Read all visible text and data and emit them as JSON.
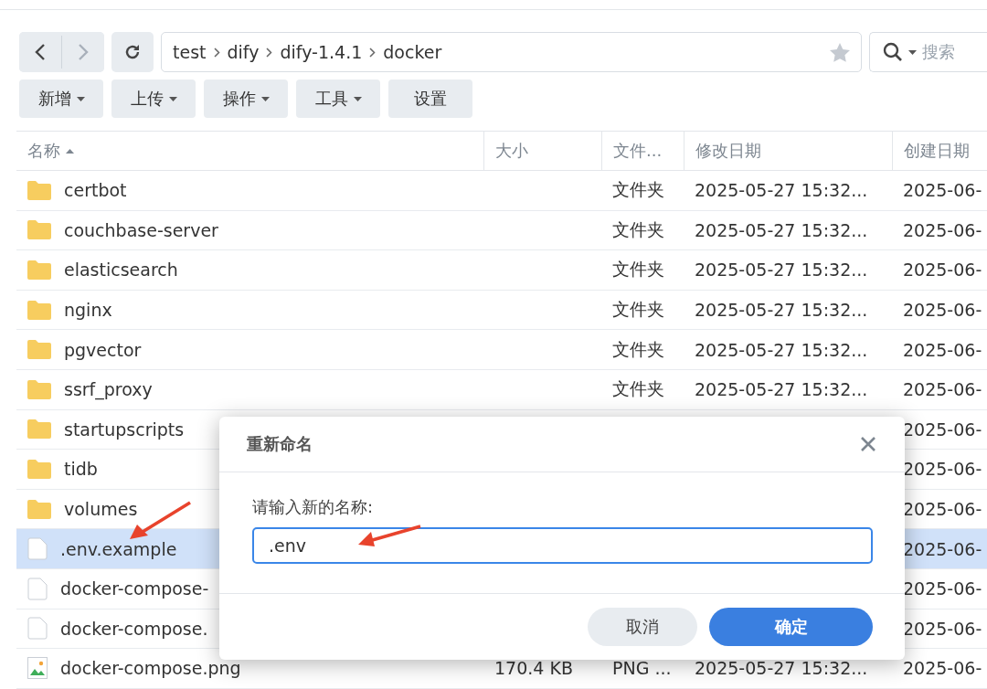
{
  "breadcrumb": [
    "test",
    "dify",
    "dify-1.4.1",
    "docker"
  ],
  "search": {
    "placeholder": "搜索"
  },
  "toolbar": [
    {
      "label": "新增",
      "dropdown": true
    },
    {
      "label": "上传",
      "dropdown": true
    },
    {
      "label": "操作",
      "dropdown": true
    },
    {
      "label": "工具",
      "dropdown": true
    },
    {
      "label": "设置",
      "dropdown": false
    }
  ],
  "table": {
    "columns": [
      {
        "label": "名称",
        "sorted": true
      },
      {
        "label": "大小",
        "sorted": false
      },
      {
        "label": "文件...",
        "sorted": false
      },
      {
        "label": "修改日期",
        "sorted": false
      },
      {
        "label": "创建日期",
        "sorted": false
      }
    ],
    "rows": [
      {
        "kind": "folder",
        "name": "certbot",
        "type": "文件夹",
        "modified": "2025-05-27 15:32...",
        "created": "2025-06-",
        "selected": false
      },
      {
        "kind": "folder",
        "name": "couchbase-server",
        "type": "文件夹",
        "modified": "2025-05-27 15:32...",
        "created": "2025-06-",
        "selected": false
      },
      {
        "kind": "folder",
        "name": "elasticsearch",
        "type": "文件夹",
        "modified": "2025-05-27 15:32...",
        "created": "2025-06-",
        "selected": false
      },
      {
        "kind": "folder",
        "name": "nginx",
        "type": "文件夹",
        "modified": "2025-05-27 15:32...",
        "created": "2025-06-",
        "selected": false
      },
      {
        "kind": "folder",
        "name": "pgvector",
        "type": "文件夹",
        "modified": "2025-05-27 15:32...",
        "created": "2025-06-",
        "selected": false
      },
      {
        "kind": "folder",
        "name": "ssrf_proxy",
        "type": "文件夹",
        "modified": "2025-05-27 15:32...",
        "created": "2025-06-",
        "selected": false
      },
      {
        "kind": "folder",
        "name": "startupscripts",
        "created": "2025-06-",
        "selected": false
      },
      {
        "kind": "folder",
        "name": "tidb",
        "created": "2025-06-",
        "selected": false
      },
      {
        "kind": "folder",
        "name": "volumes",
        "created": "2025-06-",
        "selected": false
      },
      {
        "kind": "file",
        "name": ".env.example",
        "created": "2025-06-",
        "selected": true
      },
      {
        "kind": "file",
        "name": "docker-compose-",
        "created": "2025-06-",
        "selected": false
      },
      {
        "kind": "file",
        "name": "docker-compose.",
        "created": "2025-06-",
        "selected": false
      },
      {
        "kind": "image",
        "name": "docker-compose.png",
        "size": "170.4 KB",
        "type": "PNG ...",
        "modified": "2025-05-27 15:32...",
        "created": "2025-06-",
        "selected": false
      }
    ]
  },
  "dialog": {
    "title": "重新命名",
    "label": "请输入新的名称:",
    "value": ".env",
    "buttons": [
      {
        "label": "取消",
        "primary": false
      },
      {
        "label": "确定",
        "primary": true
      }
    ]
  }
}
